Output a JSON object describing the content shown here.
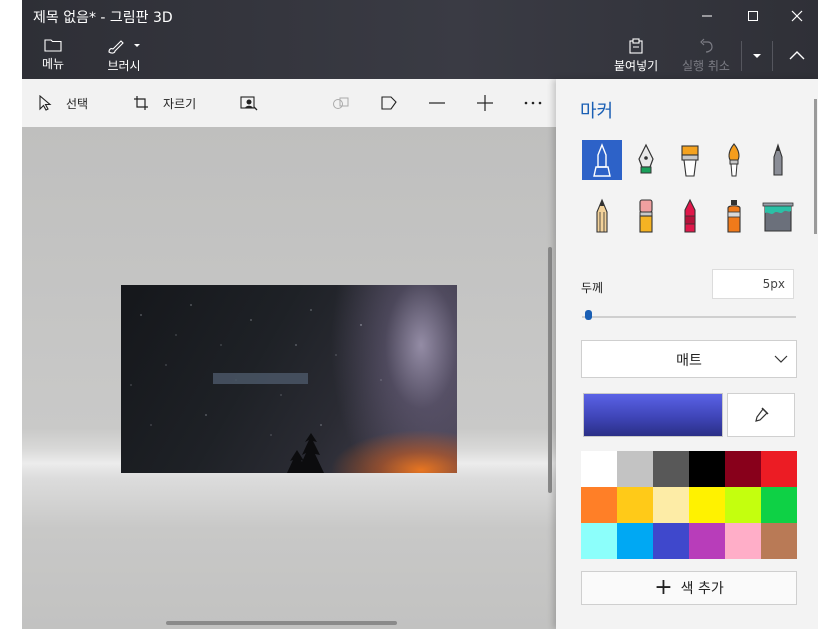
{
  "window": {
    "title": "제목 없음* - 그림판 3D"
  },
  "ribbon": {
    "menu_label": "메뉴",
    "brushes_label": "브러시",
    "paste_label": "붙여넣기",
    "undo_label": "실행 취소"
  },
  "toolbar": {
    "select_label": "선택",
    "crop_label": "자르기"
  },
  "panel": {
    "title": "마커",
    "tools": [
      "marker-icon",
      "calligraphy-pen-icon",
      "oil-brush-icon",
      "watercolor-icon",
      "pixel-pen-icon",
      "pencil-icon",
      "eraser-icon",
      "crayon-icon",
      "spray-can-icon",
      "fill-bucket-icon"
    ],
    "thickness_label": "두께",
    "thickness_value": "5px",
    "thickness_level": 0.03,
    "finish_value": "매트",
    "current_color": "#3f45b8",
    "add_color_label": "색 추가",
    "palette": [
      "#ffffff",
      "#c3c3c3",
      "#585858",
      "#000000",
      "#88001b",
      "#ec1c24",
      "#ff7f27",
      "#ffca18",
      "#fdeca6",
      "#fff200",
      "#c4ff0e",
      "#0ed145",
      "#8cfffb",
      "#00a8f3",
      "#3f48cc",
      "#b83dba",
      "#ffaec8",
      "#b97a56"
    ]
  }
}
